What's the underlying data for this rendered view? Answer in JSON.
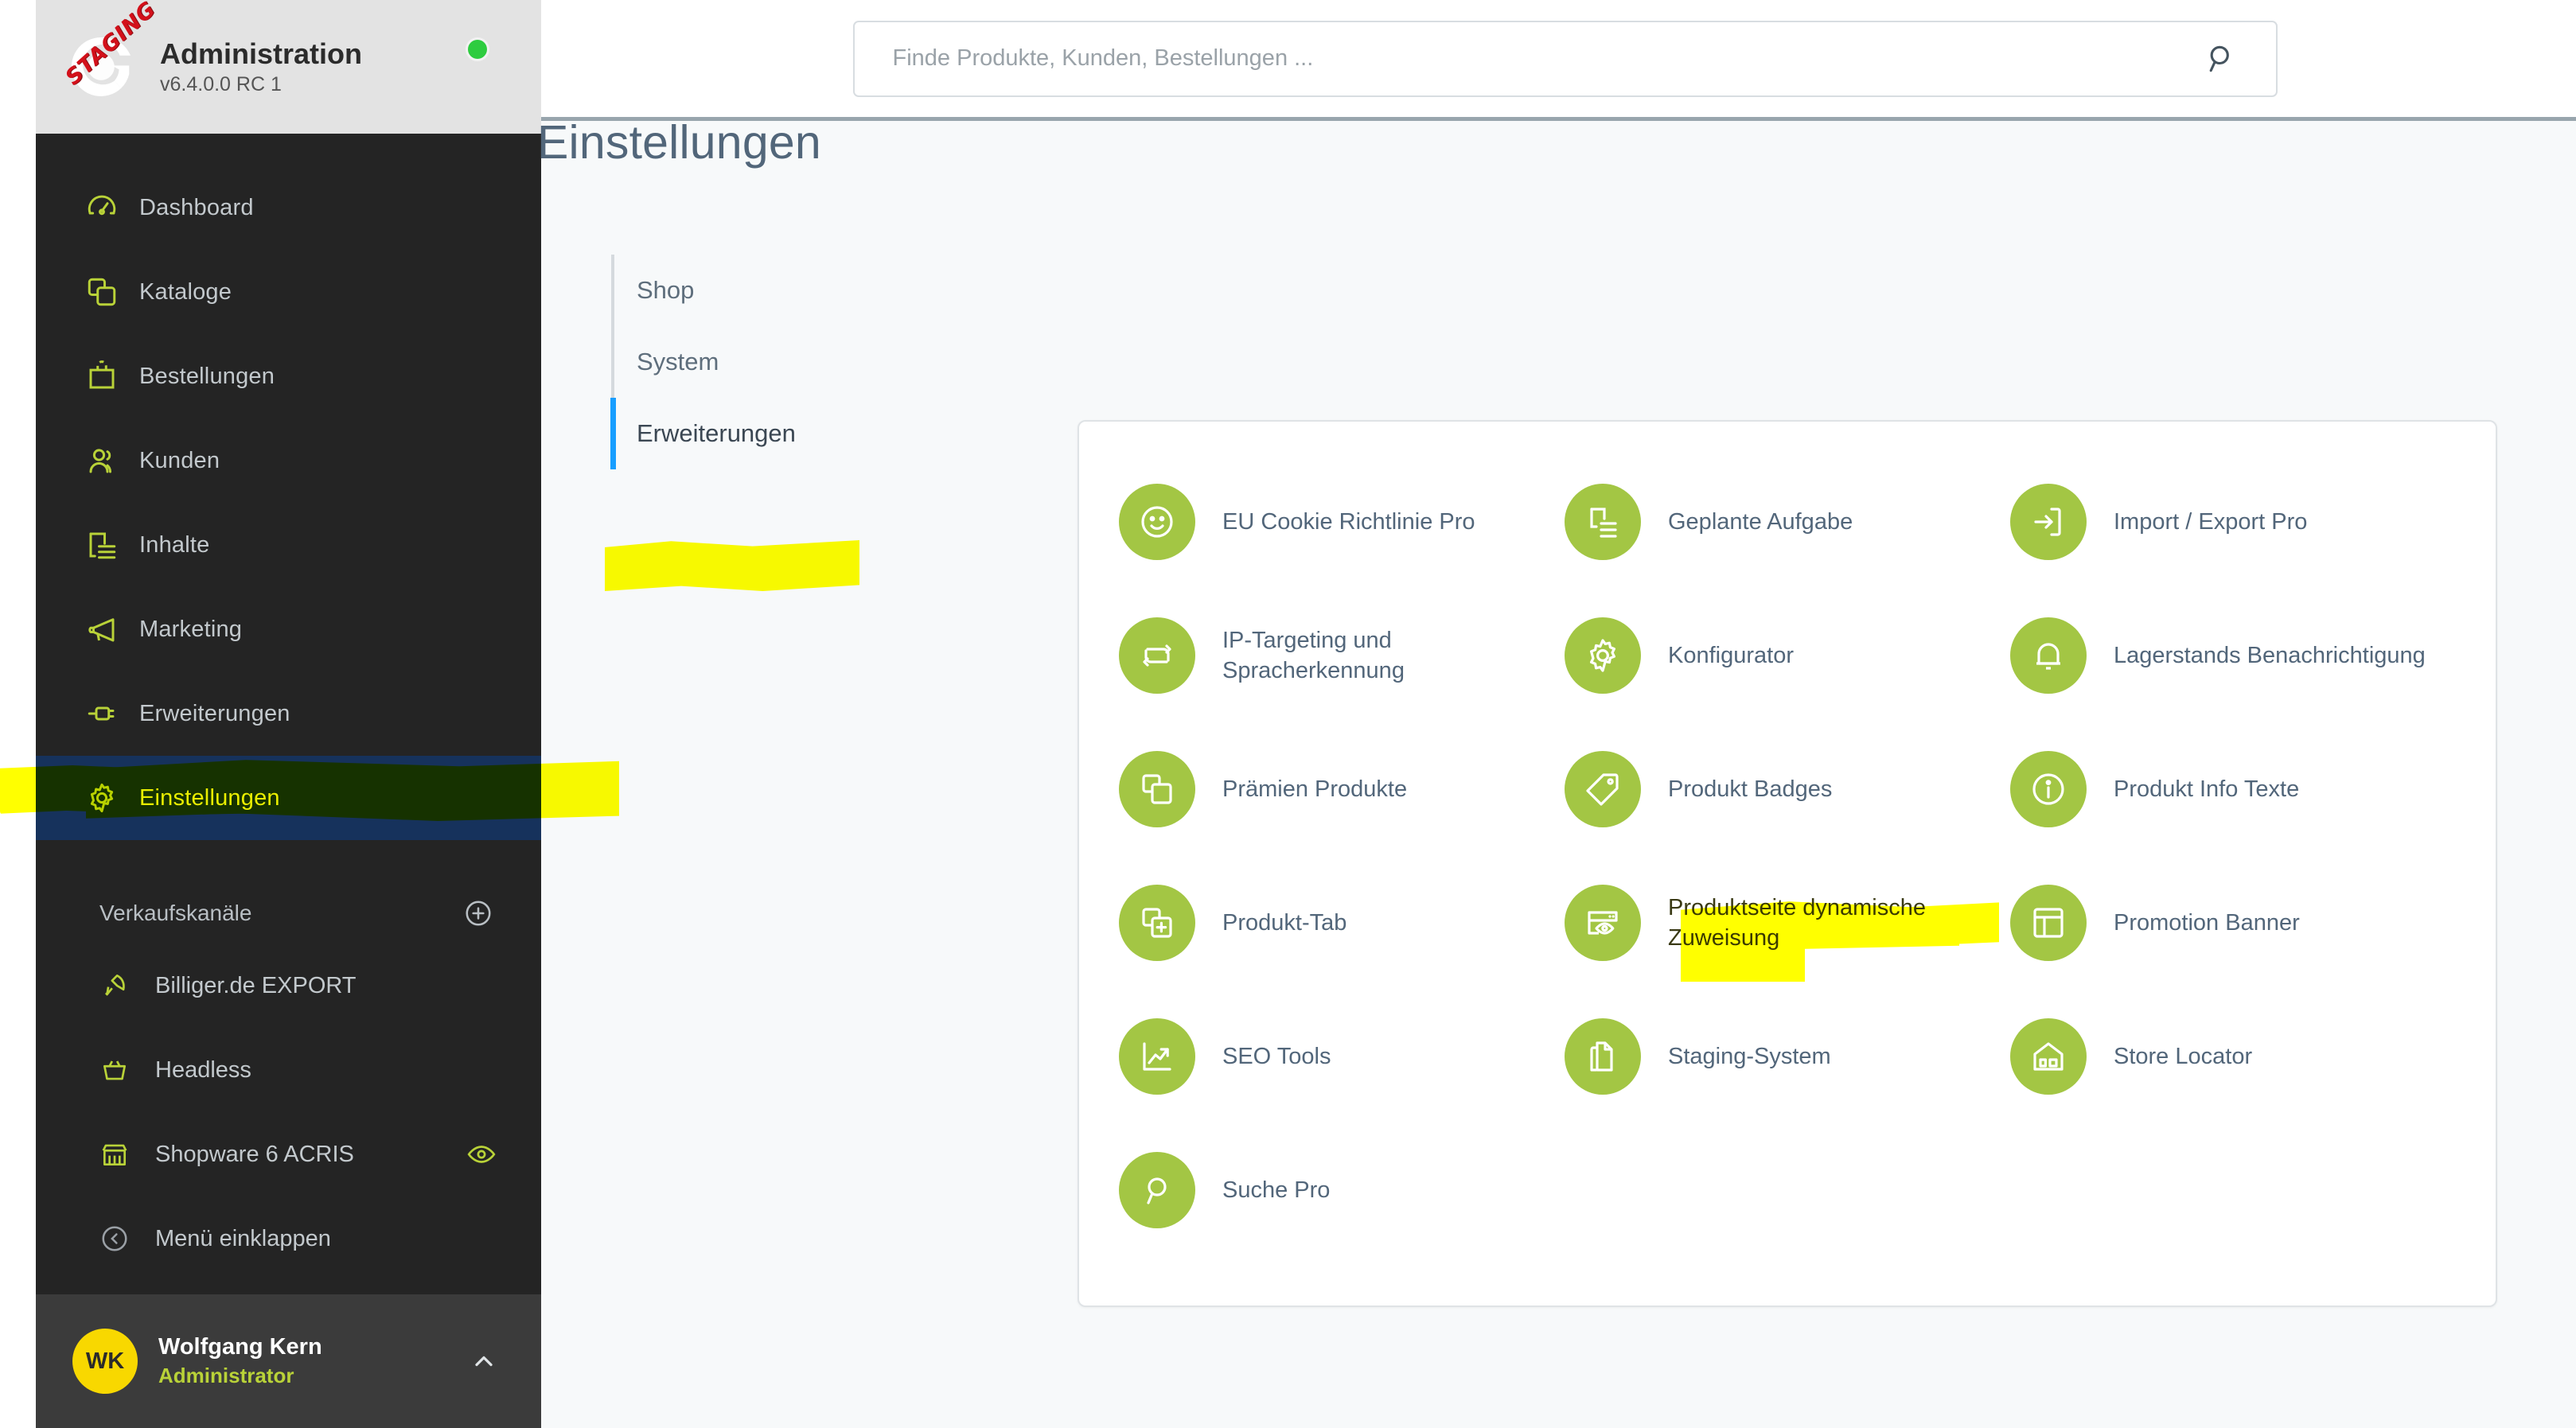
{
  "sidebar": {
    "logo_badge": "STAGING",
    "title": "Administration",
    "version": "v6.4.0.0 RC 1",
    "status": "online",
    "nav": [
      {
        "label": "Dashboard",
        "icon": "gauge-icon",
        "active": false
      },
      {
        "label": "Kataloge",
        "icon": "catalog-icon",
        "active": false
      },
      {
        "label": "Bestellungen",
        "icon": "bag-icon",
        "active": false
      },
      {
        "label": "Kunden",
        "icon": "users-icon",
        "active": false
      },
      {
        "label": "Inhalte",
        "icon": "content-icon",
        "active": false
      },
      {
        "label": "Marketing",
        "icon": "megaphone-icon",
        "active": false
      },
      {
        "label": "Erweiterungen",
        "icon": "plugin-icon",
        "active": false
      },
      {
        "label": "Einstellungen",
        "icon": "gear-icon",
        "active": true
      }
    ],
    "channels_heading": "Verkaufskanäle",
    "channels": [
      {
        "label": "Billiger.de EXPORT",
        "icon": "rocket-icon",
        "eye": false
      },
      {
        "label": "Headless",
        "icon": "basket-icon",
        "eye": false
      },
      {
        "label": "Shopware 6 ACRIS",
        "icon": "storefront-icon",
        "eye": true
      }
    ],
    "collapse_label": "Menü einklappen",
    "user": {
      "initials": "WK",
      "name": "Wolfgang Kern",
      "role": "Administrator"
    }
  },
  "topbar": {
    "search_placeholder": "Finde Produkte, Kunden, Bestellungen ...",
    "search_value": ""
  },
  "main": {
    "page_title": "Einstellungen",
    "settings_nav": [
      {
        "label": "Shop",
        "active": false
      },
      {
        "label": "System",
        "active": false
      },
      {
        "label": "Erweiterungen",
        "active": true
      }
    ],
    "extensions": [
      {
        "label": "EU Cookie Richtlinie Pro",
        "icon": "smiley-icon",
        "highlighted": false
      },
      {
        "label": "Geplante Aufgabe",
        "icon": "task-list-icon",
        "highlighted": false
      },
      {
        "label": "Import / Export Pro",
        "icon": "login-arrow-icon",
        "highlighted": false
      },
      {
        "label": "IP-Targeting und Spracherkennung",
        "icon": "loop-arrows-icon",
        "highlighted": false
      },
      {
        "label": "Konfigurator",
        "icon": "gear-icon",
        "highlighted": false
      },
      {
        "label": "Lagerstands Benachrichtigung",
        "icon": "bell-icon",
        "highlighted": false
      },
      {
        "label": "Prämien Produkte",
        "icon": "copy-icon",
        "highlighted": false
      },
      {
        "label": "Produkt Badges",
        "icon": "tag-icon",
        "highlighted": false
      },
      {
        "label": "Produkt Info Texte",
        "icon": "info-circle-icon",
        "highlighted": false
      },
      {
        "label": "Produkt-Tab",
        "icon": "copy-plus-icon",
        "highlighted": false
      },
      {
        "label": "Produktseite dynamische Zuweisung",
        "icon": "page-preview-icon",
        "highlighted": true
      },
      {
        "label": "Promotion Banner",
        "icon": "layout-icon",
        "highlighted": false
      },
      {
        "label": "SEO Tools",
        "icon": "trend-up-icon",
        "highlighted": false
      },
      {
        "label": "Staging-System",
        "icon": "duplicate-icon",
        "highlighted": false
      },
      {
        "label": "Store Locator",
        "icon": "shop-house-icon",
        "highlighted": false
      },
      {
        "label": "Suche Pro",
        "icon": "search-circle-icon",
        "highlighted": false
      }
    ]
  },
  "annotations": {
    "highlight_color": "#ffff00",
    "highlighted_labels": [
      "Einstellungen",
      "Erweiterungen",
      "Produktseite dynamische Zuweisung"
    ]
  },
  "colors": {
    "accent_green": "#a3c644",
    "sidebar_bg": "#242424",
    "active_nav_bg": "#16325c",
    "text_muted": "#52667a",
    "status_online": "#2ecc40",
    "avatar_bg": "#f8d800",
    "active_indicator_blue": "#189eff"
  }
}
